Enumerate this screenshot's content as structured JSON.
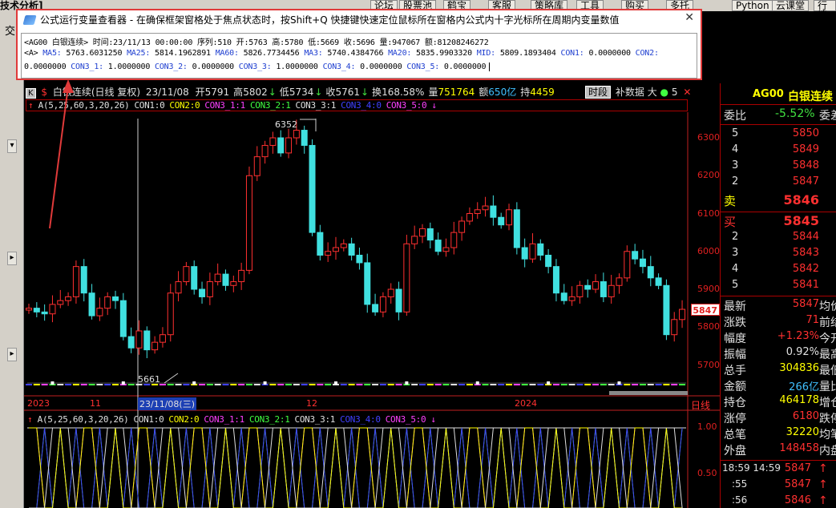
{
  "app": {
    "title_fragment": "技术分析]",
    "toolbar": [
      "论坛",
      "股票池",
      "鹤宝",
      "客服",
      "策略库",
      "工具",
      "购买",
      "多托",
      "Python",
      "云课堂",
      "行情"
    ],
    "left_label": "交"
  },
  "popup": {
    "title": "公式运行变量查看器 - 在确保框架窗格处于焦点状态时，按Shift+Q 快捷键快速定位鼠标所在窗格内公式内十字光标所在周期内变量数值",
    "line1": "<AG00 白银连续> 时间:23/11/13 00:00:00 序列:510 开:5763 高:5780 低:5669 收:5696 量:947067 额:81208246272",
    "line2_prefix": "<A> ",
    "line2_vars": [
      {
        "k": "MA5:",
        "v": " 5763.6031250 "
      },
      {
        "k": "MA25:",
        "v": " 5814.1962891 "
      },
      {
        "k": "MA60:",
        "v": " 5826.7734456 "
      },
      {
        "k": "MA3:",
        "v": " 5740.4384766 "
      },
      {
        "k": "MA20:",
        "v": " 5835.9903320 "
      },
      {
        "k": "MID:",
        "v": " 5809.1893404 "
      },
      {
        "k": "CON1:",
        "v": " 0.0000000 "
      },
      {
        "k": "CON2:",
        "v": ""
      }
    ],
    "line3_lead": "0.0000000 ",
    "line3_vars": [
      {
        "k": "CON3_1:",
        "v": " 1.0000000 "
      },
      {
        "k": "CON3_2:",
        "v": " 0.0000000 "
      },
      {
        "k": "CON3_3:",
        "v": " 1.0000000 "
      },
      {
        "k": "CON3_4:",
        "v": " 0.0000000 "
      },
      {
        "k": "CON3_5:",
        "v": " 0.0000000"
      }
    ]
  },
  "chart": {
    "status_left": "K",
    "status_symbol": "$",
    "status_name": "白银连续(日线 复权)",
    "status_date": "23/11/08",
    "status_items": [
      {
        "label": "开",
        "value": "5791"
      },
      {
        "label": "高",
        "value": "5802"
      },
      {
        "label": "低",
        "value": "5734"
      },
      {
        "label": "收",
        "value": "5761"
      },
      {
        "label": "换",
        "value": "168.58%"
      },
      {
        "label": "量",
        "value": "751764"
      },
      {
        "label": "额",
        "value": "650亿"
      },
      {
        "label": "持",
        "value": "4459"
      }
    ],
    "status_right": [
      "时段",
      "补数据",
      "大",
      "5",
      "a"
    ],
    "indicator_main": {
      "prefix": "A(5,25,60,3,20,26)",
      "items": [
        {
          "text": "CON1:0",
          "color": "#e0e0e0"
        },
        {
          "text": "CON2:0",
          "color": "#ffff00"
        },
        {
          "text": "CON3_1:1",
          "color": "#ff40ff"
        },
        {
          "text": "CON3_2:1",
          "color": "#40ff40"
        },
        {
          "text": "CON3_3:1",
          "color": "#e0e0e0"
        },
        {
          "text": "CON3_4:0",
          "color": "#4040ff"
        },
        {
          "text": "CON3_5:0",
          "color": "#ff40ff"
        }
      ]
    },
    "price_ticks": [
      "6300",
      "6200",
      "6100",
      "6000",
      "5900",
      "5800",
      "5700"
    ],
    "current_price_tag": "5847",
    "hi_label": "6352",
    "lo_label": "5661",
    "time_axis": [
      "2023",
      "11",
      "23/11/08(三)",
      "12",
      "2024"
    ],
    "period_label": "日线",
    "sub_ticks": [
      "1.00",
      "0.50"
    ]
  },
  "quote": {
    "code": "AG00",
    "name": "白银连续",
    "weibi_label": "委比",
    "weibi_value": "-5.52%",
    "weibi_ext": "委差",
    "asks": [
      {
        "level": "5",
        "price": "5850"
      },
      {
        "level": "4",
        "price": "5849"
      },
      {
        "level": "3",
        "price": "5848"
      },
      {
        "level": "2",
        "price": "5847"
      }
    ],
    "sell_label": "卖",
    "sell_price": "5846",
    "buy_label": "买",
    "buy_price": "5845",
    "bids": [
      {
        "level": "2",
        "price": "5844"
      },
      {
        "level": "3",
        "price": "5843"
      },
      {
        "level": "4",
        "price": "5842"
      },
      {
        "level": "5",
        "price": "5841"
      }
    ],
    "stats": [
      {
        "label": "最新",
        "value": "5847",
        "color": "#ff3030",
        "ext": "均价"
      },
      {
        "label": "涨跌",
        "value": "71",
        "color": "#ff3030",
        "ext": "前结"
      },
      {
        "label": "幅度",
        "value": "+1.23%",
        "color": "#ff3030",
        "ext": "今开"
      },
      {
        "label": "振幅",
        "value": "0.92%",
        "color": "#e0e0e0",
        "ext": "最高"
      },
      {
        "label": "总手",
        "value": "304836",
        "color": "#ffff00",
        "ext": "最低"
      },
      {
        "label": "金额",
        "value": "266亿",
        "color": "#40c0ff",
        "ext": "量比"
      },
      {
        "label": "持仓",
        "value": "464178",
        "color": "#ffff00",
        "ext": "增仓"
      },
      {
        "label": "涨停",
        "value": "6180",
        "color": "#ff3030",
        "ext": "跌停"
      },
      {
        "label": "总笔",
        "value": "32220",
        "color": "#ffff00",
        "ext": "均笔"
      },
      {
        "label": "外盘",
        "value": "148458",
        "color": "#ff3030",
        "ext": "内盘"
      }
    ],
    "ticks": [
      {
        "time": "18:59 14:59",
        "price": "5847"
      },
      {
        "time": ":55",
        "price": "5847"
      },
      {
        "time": ":56",
        "price": "5846"
      }
    ]
  },
  "colors": {
    "up": "#ff3030",
    "down": "#40e0e0",
    "highlight": "#e03a3a"
  }
}
